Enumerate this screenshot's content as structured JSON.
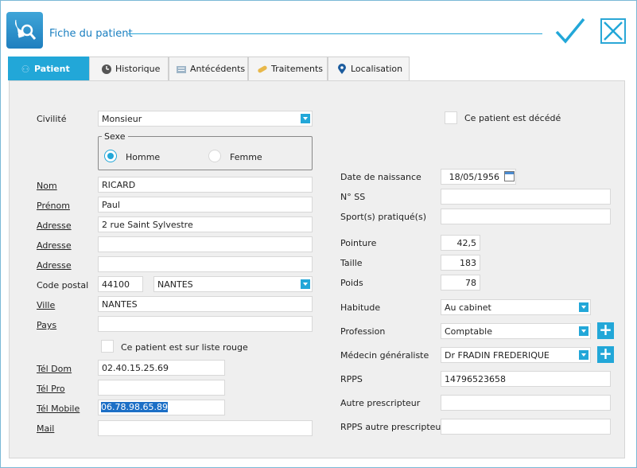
{
  "window": {
    "title": "Fiche du patient",
    "accent": "#22a7d8"
  },
  "tabs": [
    {
      "label": "Patient",
      "icon": "people-icon",
      "active": true
    },
    {
      "label": "Historique",
      "icon": "clock-icon",
      "active": false
    },
    {
      "label": "Antécédents",
      "icon": "folder-icon",
      "active": false
    },
    {
      "label": "Traitements",
      "icon": "pill-icon",
      "active": false
    },
    {
      "label": "Localisation",
      "icon": "map-pin-icon",
      "active": false
    }
  ],
  "left": {
    "civilite_label": "Civilité",
    "civilite_value": "Monsieur",
    "sexe_legend": "Sexe",
    "sexe_homme": "Homme",
    "sexe_femme": "Femme",
    "nom_label": "Nom",
    "nom_value": "RICARD",
    "prenom_label": "Prénom",
    "prenom_value": "Paul",
    "adresse_label": "Adresse",
    "adresse1_value": "2 rue Saint Sylvestre",
    "adresse2_value": "",
    "adresse3_value": "",
    "code_postal_label": "Code postal",
    "code_postal_value": "44100",
    "commune_value": "NANTES",
    "ville_label": "Ville",
    "ville_value": "NANTES",
    "pays_label": "Pays",
    "pays_value": "",
    "liste_rouge_label": "Ce patient est sur liste rouge",
    "tel_dom_label": "Tél Dom",
    "tel_dom_value": "02.40.15.25.69",
    "tel_pro_label": "Tél Pro",
    "tel_pro_value": "",
    "tel_mobile_label": "Tél Mobile",
    "tel_mobile_value": "06.78.98.65.89",
    "mail_label": "Mail",
    "mail_value": ""
  },
  "right": {
    "decede_label": "Ce patient est décédé",
    "naissance_label": "Date de naissance",
    "naissance_value": "18/05/1956",
    "ss_label": "N° SS",
    "ss_value": "",
    "sport_label": "Sport(s) pratiqué(s)",
    "sport_value": "",
    "pointure_label": "Pointure",
    "pointure_value": "42,5",
    "taille_label": "Taille",
    "taille_value": "183",
    "poids_label": "Poids",
    "poids_value": "78",
    "habitude_label": "Habitude",
    "habitude_value": "Au cabinet",
    "profession_label": "Profession",
    "profession_value": "Comptable",
    "medecin_label": "Médecin généraliste",
    "medecin_value": "Dr FRADIN FREDERIQUE",
    "rpps_label": "RPPS",
    "rpps_value": "14796523658",
    "autre_prescripteur_label": "Autre prescripteur",
    "autre_prescripteur_value": "",
    "rpps_autre_label": "RPPS autre prescripteur",
    "rpps_autre_value": ""
  }
}
